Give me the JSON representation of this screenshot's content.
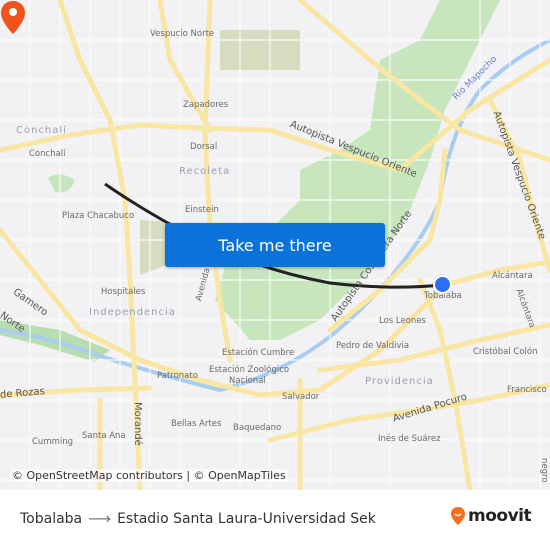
{
  "map": {
    "labels": {
      "vespucio_norte": "Vespucio Norte",
      "zapadores": "Zapadores",
      "conchali_district": "Conchalí",
      "conchali": "Conchalí",
      "dorsal": "Dorsal",
      "recoleta": "Recoleta",
      "einstein": "Einstein",
      "plaza_chacabuco": "Plaza Chacabuco",
      "hospitales": "Hospitales",
      "independencia": "Independencia",
      "gamero": "Gamero",
      "norte": "Norte",
      "avenida_peru": "Avenida Perú",
      "estacion_cumbre": "Estación Cumbre",
      "estacion_zoologico": "Estación Zoológico",
      "nacional": "Nacional",
      "patronato": "Patronato",
      "de_rozas": "de Rozas",
      "morande": "Morandé",
      "bellas_artes": "Bellas Artes",
      "baquedano": "Baquedano",
      "santa_ana": "Santa Ana",
      "cumming": "Cumming",
      "salvador": "Salvador",
      "autopista_vespucio_oriente": "Autopista Vespucio Oriente",
      "rio_mapocho": "Río Mapocho",
      "autopista_vespucio_oriente_2": "Autopista Vespucio Oriente",
      "autopista_costanera_norte": "Autopista Costanera Norte",
      "alcantara": "Alcántara",
      "alcantara_2": "Alcántara",
      "tobalaba": "Tobalaba",
      "los_leones": "Los Leones",
      "pedro_de_valdivia": "Pedro de Valdivia",
      "cristobal_colon": "Cristóbal Colón",
      "providencia": "Providencia",
      "francisco": "Francisco B",
      "avenida_pocuro": "Avenida Pocuro",
      "ines_de_suarez": "Inés de Suárez",
      "negro": "negro"
    },
    "cta_label": "Take me there",
    "attribution": "© OpenStreetMap contributors | © OpenMapTiles",
    "origin_color": "#2b6ff5",
    "destination_color": "#f0531c"
  },
  "footer": {
    "origin": "Tobalaba",
    "arrow": "⟶",
    "destination": "Estadio Santa Laura-Universidad Sek",
    "brand": "moovit",
    "brand_color": "#f36f21"
  }
}
